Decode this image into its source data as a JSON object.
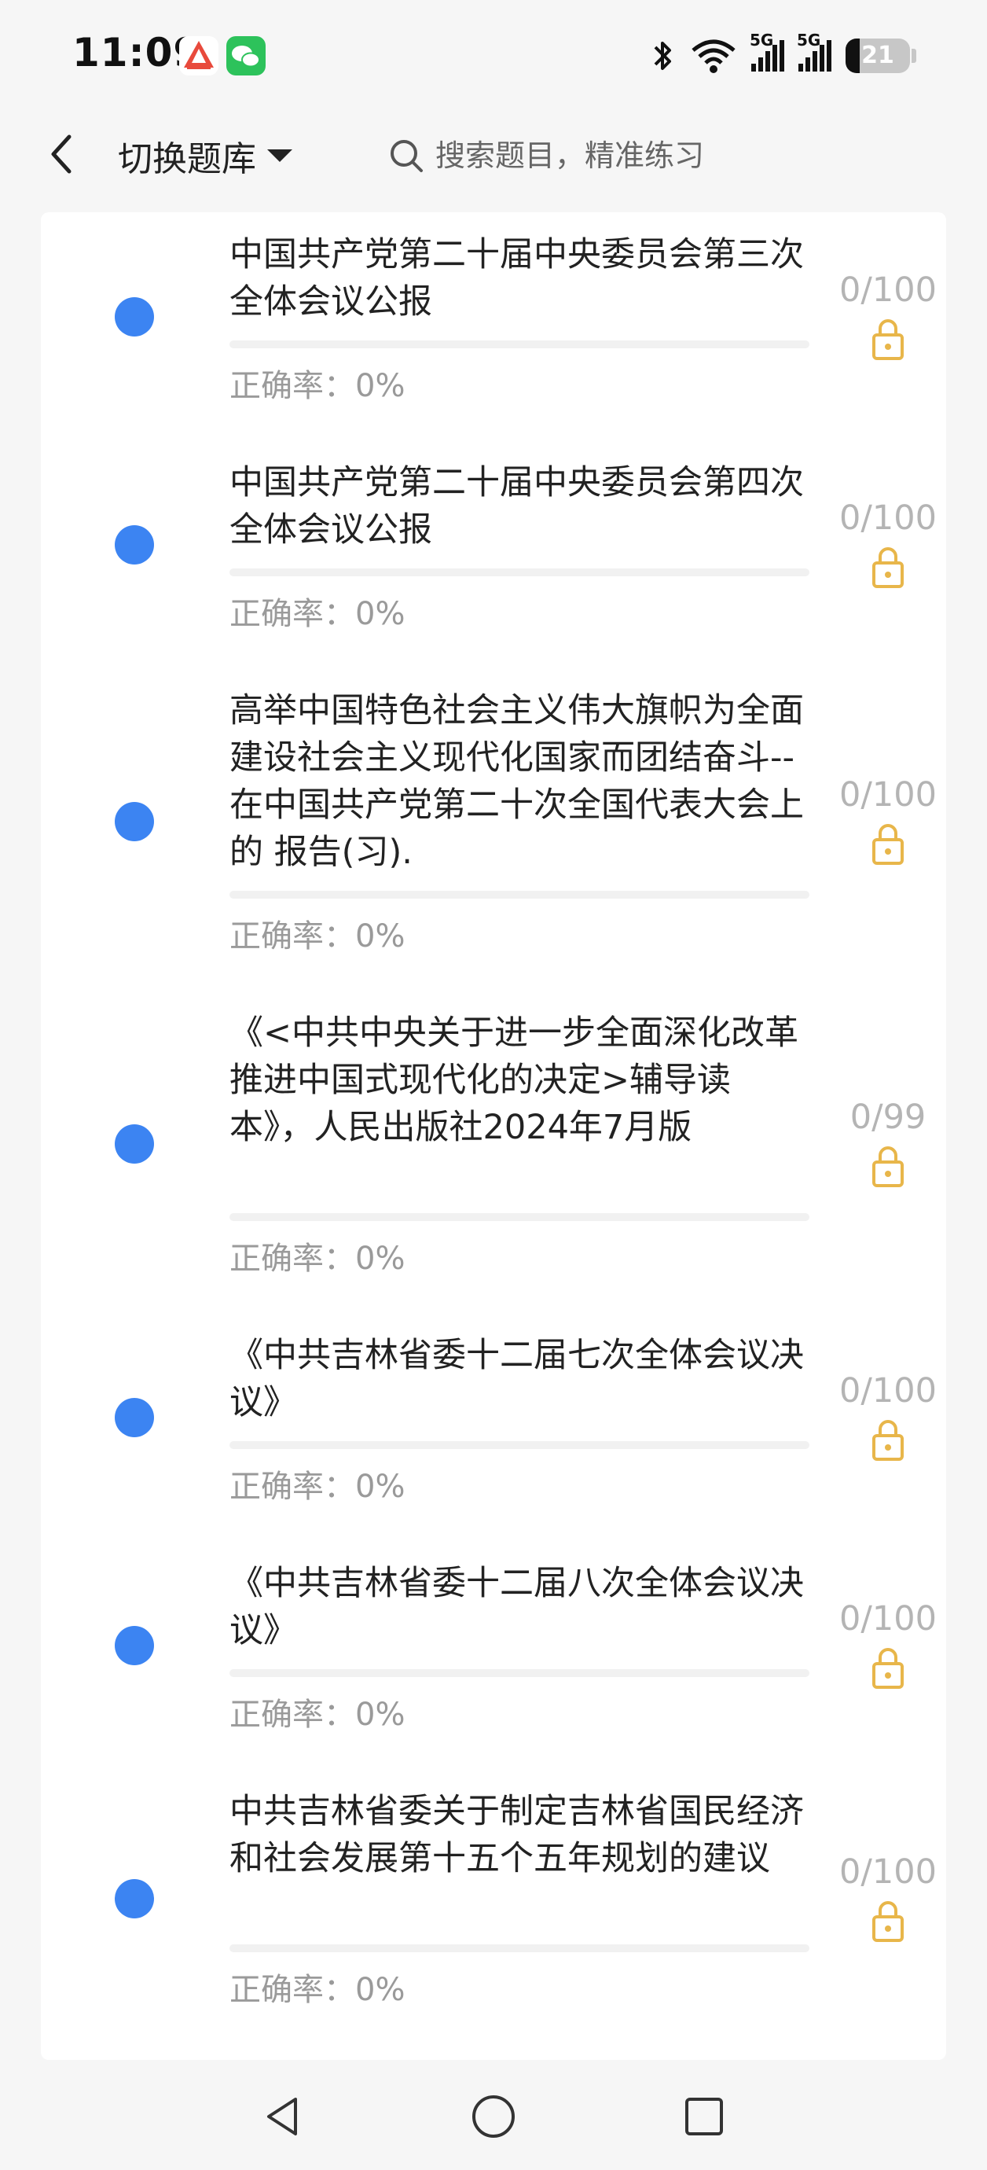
{
  "status_bar": {
    "time": "11:09",
    "network_label_1": "5G",
    "network_label_2": "5G",
    "battery": "21",
    "icons": [
      "app-red-icon",
      "wechat-icon",
      "bluetooth-icon",
      "wifi-icon",
      "signal-icon",
      "signal-icon",
      "battery-icon"
    ]
  },
  "header": {
    "switch_label": "切换题库",
    "search_placeholder": "搜索题目，精准练习"
  },
  "accuracy_label": "正确率：",
  "items": [
    {
      "title": "中国共产党第二十届中央委员会第三次全体会议公报",
      "accuracy": "0%",
      "count": "0/100",
      "progress": 0
    },
    {
      "title": "中国共产党第二十届中央委员会第四次全体会议公报",
      "accuracy": "0%",
      "count": "0/100",
      "progress": 0
    },
    {
      "title": "高举中国特色社会主义伟大旗帜为全面建设社会主义现代化国家而团结奋斗--在中国共产党第二十次全国代表大会上的 报告(习).",
      "accuracy": "0%",
      "count": "0/100",
      "progress": 0
    },
    {
      "title": "《<中共中央关于进一步全面深化改革推进中国式现代化的决定>辅导读本》，人民出版社2024年7月版",
      "accuracy": "0%",
      "count": "0/99",
      "progress": 0
    },
    {
      "title": "《中共吉林省委十二届七次全体会议决议》",
      "accuracy": "0%",
      "count": "0/100",
      "progress": 0
    },
    {
      "title": "《中共吉林省委十二届八次全体会议决议》",
      "accuracy": "0%",
      "count": "0/100",
      "progress": 0
    },
    {
      "title": "中共吉林省委关于制定吉林省国民经济和社会发展第十五个五年规划的建议",
      "accuracy": "0%",
      "count": "0/100",
      "progress": 0
    }
  ],
  "colors": {
    "dot": "#3c84f2",
    "lock": "#e8b64a",
    "background": "#f6f6f6"
  },
  "bottom_nav": [
    "back-triangle-icon",
    "home-circle-icon",
    "recents-square-icon"
  ]
}
